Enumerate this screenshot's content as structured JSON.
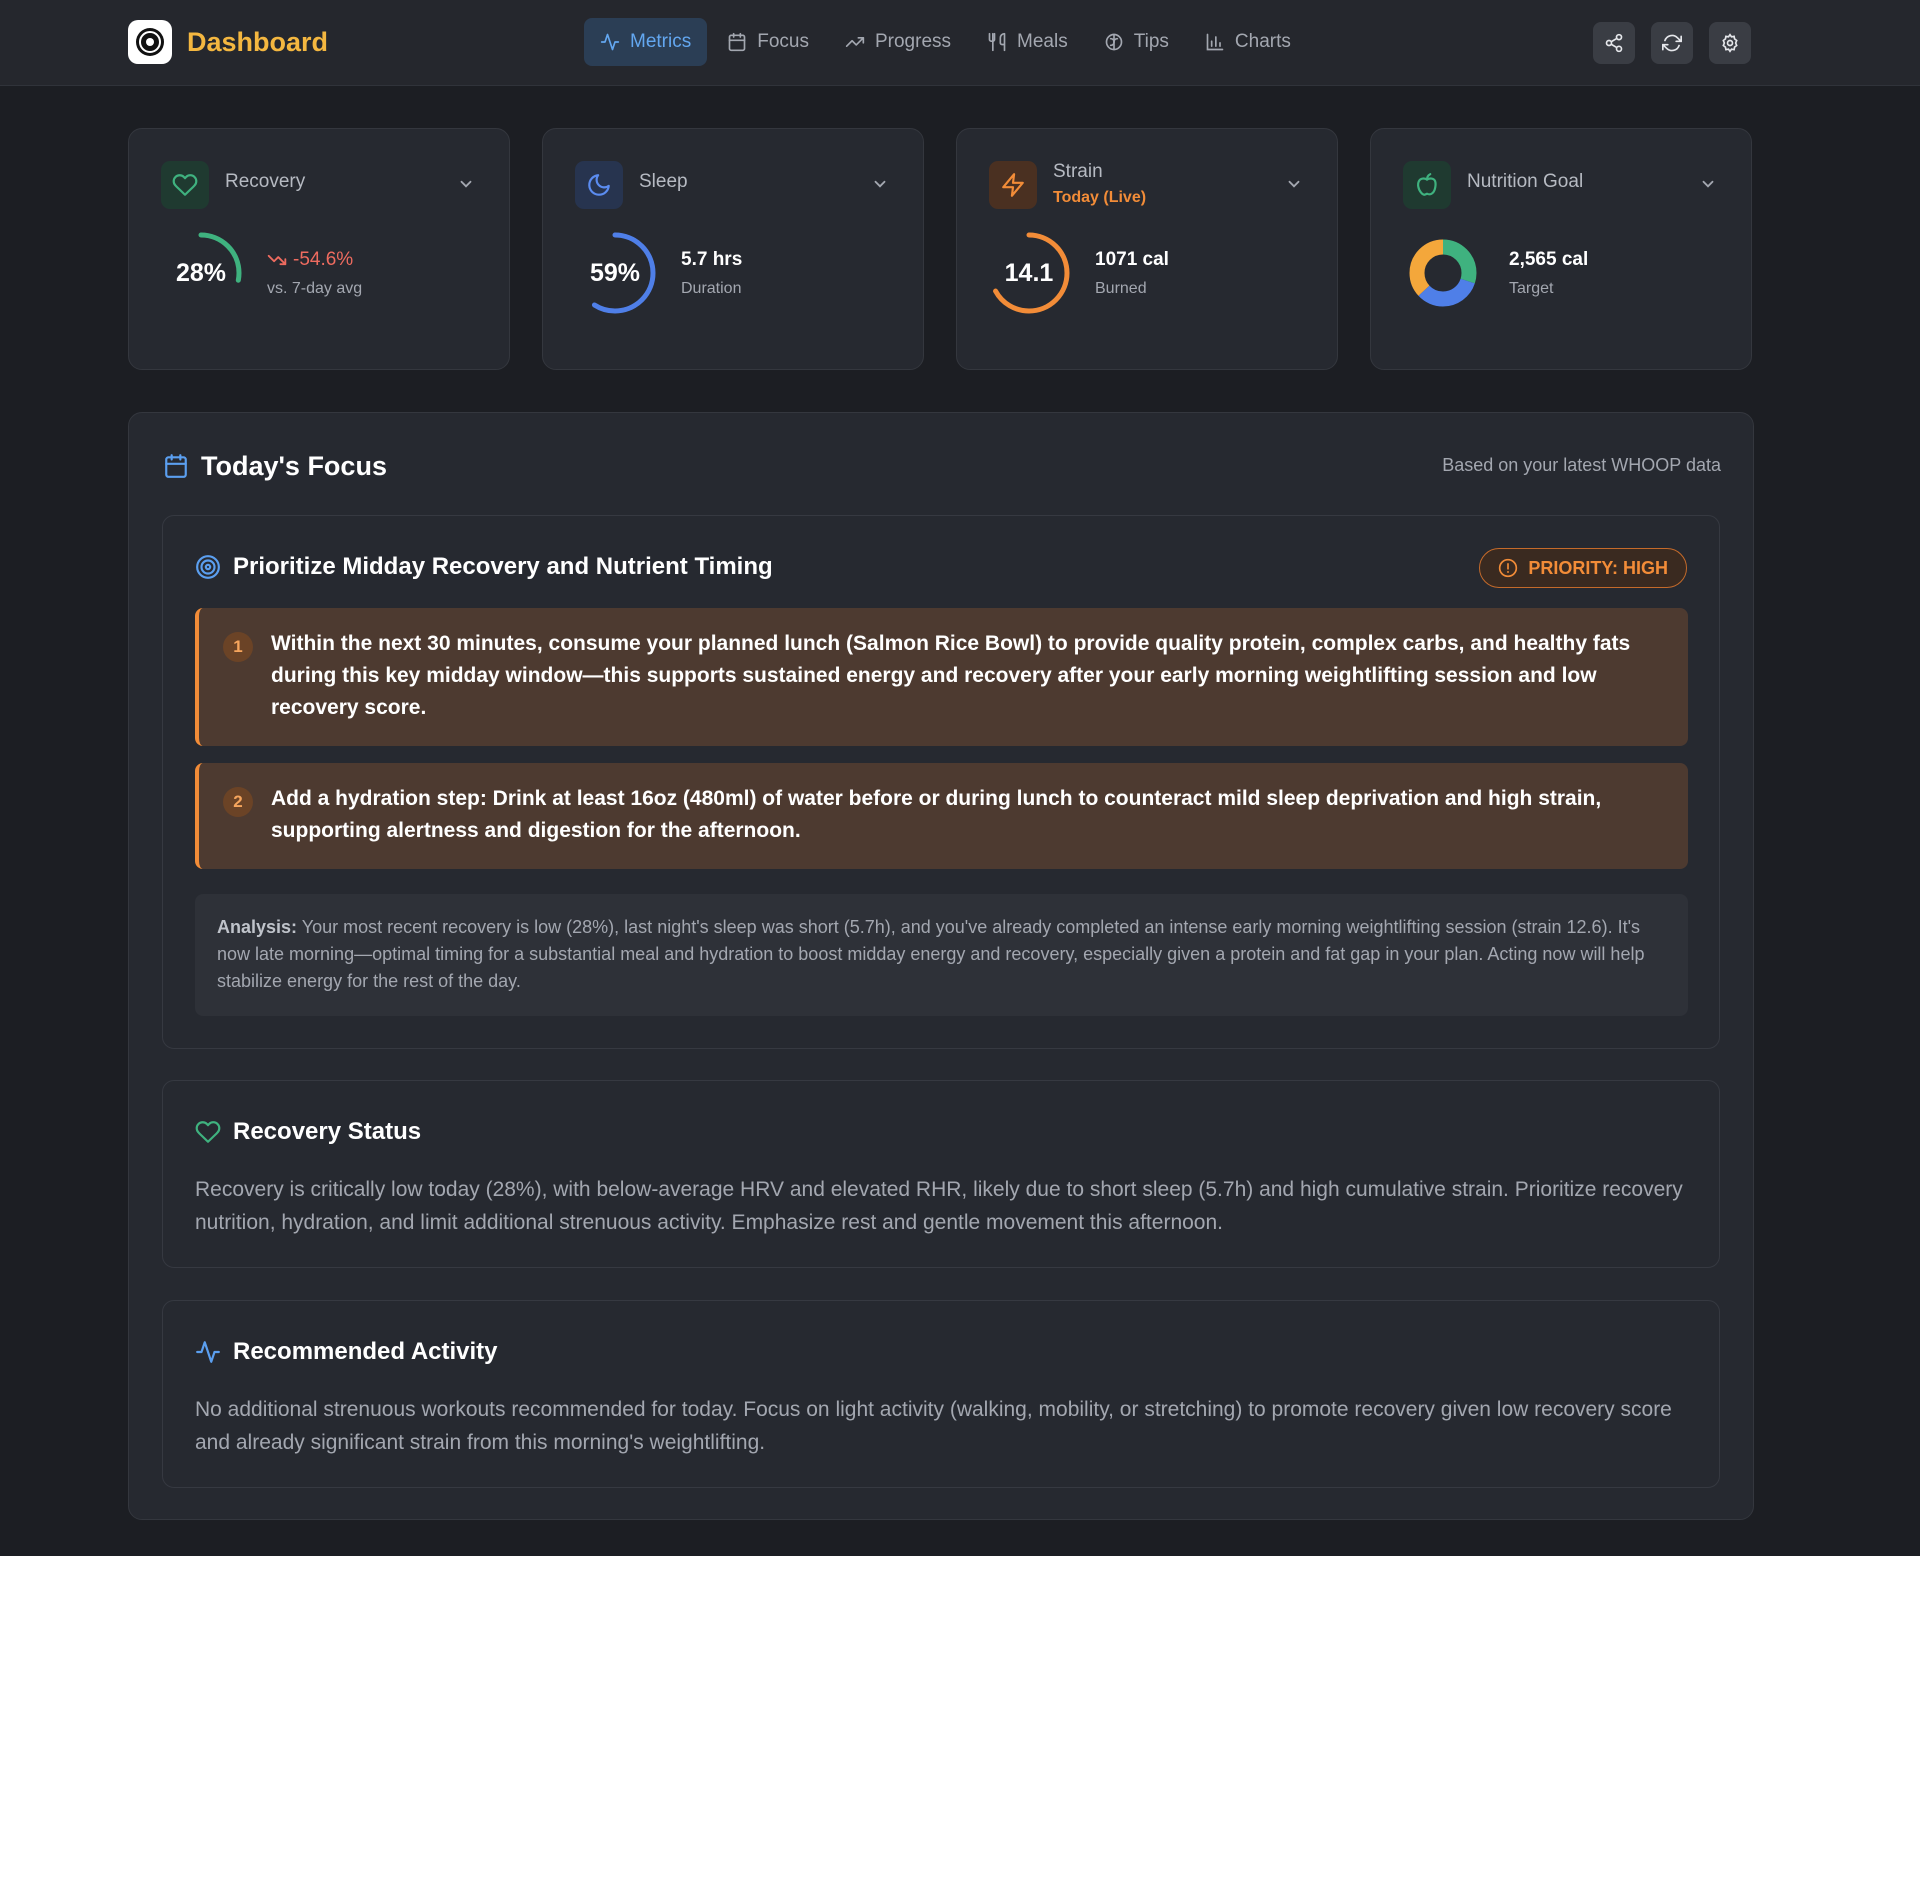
{
  "header": {
    "app_title": "Dashboard",
    "tabs": [
      {
        "label": "Metrics",
        "icon": "activity-icon"
      },
      {
        "label": "Focus",
        "icon": "calendar-icon"
      },
      {
        "label": "Progress",
        "icon": "trending-up-icon"
      },
      {
        "label": "Meals",
        "icon": "utensils-icon"
      },
      {
        "label": "Tips",
        "icon": "brain-icon"
      },
      {
        "label": "Charts",
        "icon": "bar-chart-icon"
      }
    ],
    "active_tab": "Metrics",
    "buttons": [
      "share-icon",
      "refresh-icon",
      "settings-icon"
    ]
  },
  "cards": {
    "recovery": {
      "label": "Recovery",
      "value": "28%",
      "gauge_fraction": 0.28,
      "trend": "-54.6%",
      "trend_sub": "vs. 7-day avg",
      "color": "#3fb27f"
    },
    "sleep": {
      "label": "Sleep",
      "value": "59%",
      "gauge_fraction": 0.59,
      "main": "5.7 hrs",
      "sub": "Duration",
      "color": "#4f7fe8"
    },
    "strain": {
      "label": "Strain",
      "sublabel": "Today (Live)",
      "value": "14.1",
      "gauge_fraction": 0.67,
      "main": "1071 cal",
      "sub": "Burned",
      "color": "#f28c38"
    },
    "nutrition": {
      "label": "Nutrition Goal",
      "main": "2,565 cal",
      "sub": "Target",
      "donut": [
        {
          "fraction": 0.3,
          "color": "#3fb27f"
        },
        {
          "fraction": 0.33,
          "color": "#4f7fe8"
        },
        {
          "fraction": 0.37,
          "color": "#f4a73b"
        }
      ]
    }
  },
  "focus": {
    "title": "Today's Focus",
    "note": "Based on your latest WHOOP data",
    "plan": {
      "title": "Prioritize Midday Recovery and Nutrient Timing",
      "priority": "PRIORITY: HIGH",
      "steps": [
        {
          "num": "1",
          "text": "Within the next 30 minutes, consume your planned lunch (Salmon Rice Bowl) to provide quality protein, complex carbs, and healthy fats during this key midday window—this supports sustained energy and recovery after your early morning weightlifting session and low recovery score."
        },
        {
          "num": "2",
          "text": "Add a hydration step: Drink at least 16oz (480ml) of water before or during lunch to counteract mild sleep deprivation and high strain, supporting alertness and digestion for the afternoon."
        }
      ],
      "analysis_label": "Analysis:",
      "analysis_text": " Your most recent recovery is low (28%), last night's sleep was short (5.7h), and you've already completed an intense early morning weightlifting session (strain 12.6). It's now late morning—optimal timing for a substantial meal and hydration to boost midday energy and recovery, especially given a protein and fat gap in your plan. Acting now will help stabilize energy for the rest of the day."
    },
    "recovery_status": {
      "title": "Recovery Status",
      "text": "Recovery is critically low today (28%), with below-average HRV and elevated RHR, likely due to short sleep (5.7h) and high cumulative strain. Prioritize recovery nutrition, hydration, and limit additional strenuous activity. Emphasize rest and gentle movement this afternoon."
    },
    "recommended_activity": {
      "title": "Recommended Activity",
      "text": "No additional strenuous workouts recommended for today. Focus on light activity (walking, mobility, or stretching) to promote recovery given low recovery score and already significant strain from this morning's weightlifting."
    }
  }
}
